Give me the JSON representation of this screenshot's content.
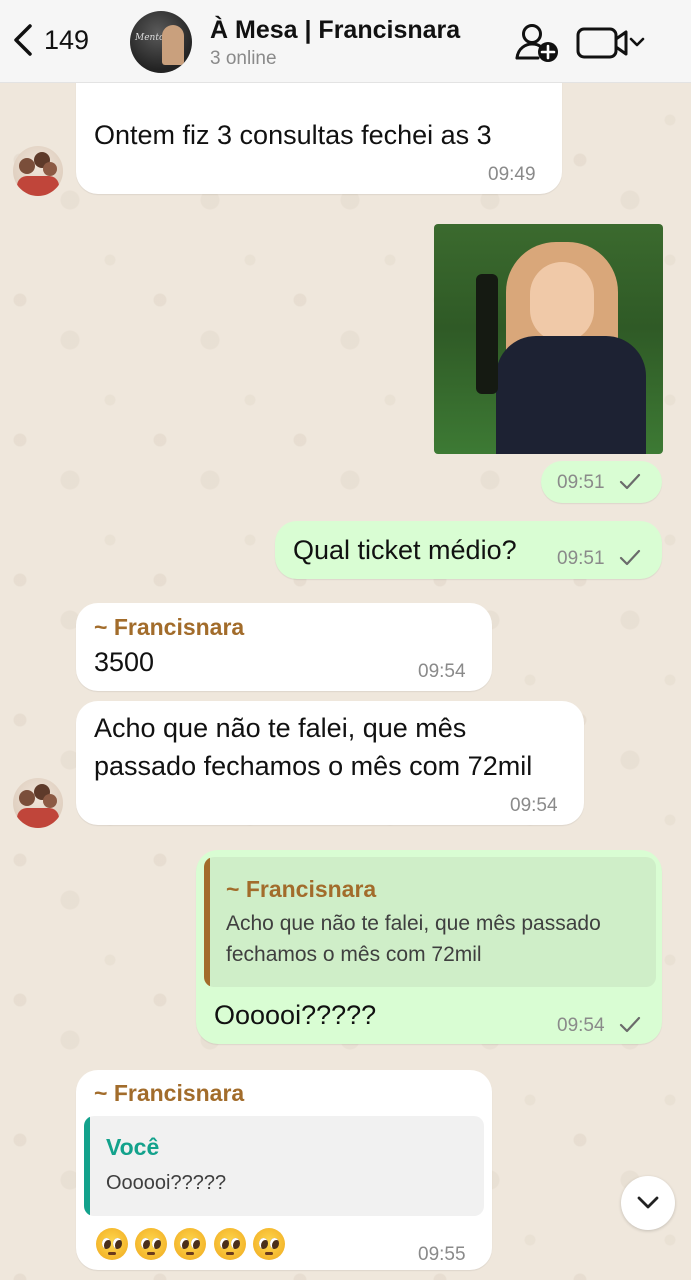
{
  "header": {
    "back_count": "149",
    "title": "À Mesa | Francisnara",
    "subtitle": "3 online",
    "avatar_text": "Mentoria",
    "icons": [
      "chevron-left-icon",
      "add-member-icon",
      "video-call-icon",
      "chevron-down-icon"
    ]
  },
  "messages": [
    {
      "direction": "in",
      "text": "Ontem fiz 3 consultas fechei as 3",
      "time": "09:49"
    },
    {
      "direction": "out",
      "type": "image",
      "time": "09:51",
      "status": "sent"
    },
    {
      "direction": "out",
      "text": "Qual ticket médio?",
      "time": "09:51",
      "status": "sent"
    },
    {
      "direction": "in",
      "sender": "~ Francisnara",
      "text": "3500",
      "time": "09:54"
    },
    {
      "direction": "in",
      "text_line1": "Acho que não te falei, que mês",
      "text_line2": "passado fechamos o mês com 72mil",
      "time": "09:54"
    },
    {
      "direction": "out",
      "quote_sender": "~ Francisnara",
      "quote_line1": "Acho que não te falei, que mês passado",
      "quote_line2": "fechamos o mês com 72mil",
      "text": "Oooooi?????",
      "time": "09:54",
      "status": "sent"
    },
    {
      "direction": "in",
      "sender": "~ Francisnara",
      "quote_sender": "Você",
      "quote_text": "Oooooi?????",
      "emojis": "🥺🥺🥺🥺🥺",
      "time": "09:55"
    }
  ],
  "colors": {
    "outgoing_bubble": "#d9fdd3",
    "incoming_bubble": "#ffffff",
    "sender_name": "#a26c2b",
    "you_name": "#13a28c",
    "chat_background": "#efe7dc"
  }
}
